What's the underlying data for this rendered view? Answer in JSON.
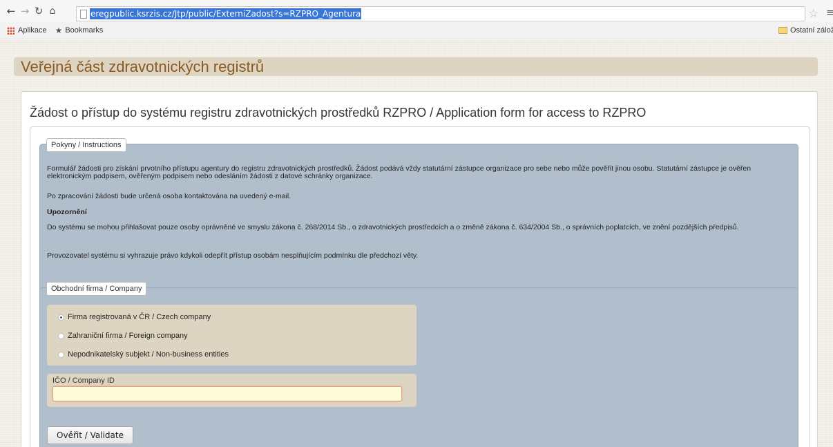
{
  "browser": {
    "url": "eregpublic.ksrzis.cz/Jtp/public/ExterniZadost?s=RZPRO_Agentura",
    "bookmarks": {
      "apps_label": "Aplikace",
      "bookmarks_label": "Bookmarks",
      "other_label": "Ostatní záložky"
    }
  },
  "site": {
    "title": "Veřejná část zdravotnických registrů"
  },
  "form": {
    "title": "Žádost o přístup do systému registru zdravotnických prostředků RZPRO / Application form for access to RZPRO",
    "instructions": {
      "legend": "Pokyny / Instructions",
      "p1": "Formulář žádosti pro získání prvotního přístupu agentury do registru zdravotnických prostředků. Žádost podává vždy statutární zástupce organizace pro sebe nebo může pověřit jinou osobu. Statutární zástupce je ověřen elektronickým podpisem, ověřeným podpisem nebo odesláním žádosti z datové schránky organizace.",
      "p2": "Po zpracování žádosti bude určená osoba kontaktována na uvedený e-mail.",
      "warning_heading": "Upozornění",
      "p3": "Do systému se mohou přihlašovat pouze osoby oprávněné ve smyslu zákona č. 268/2014 Sb., o zdravotnických prostředcích a o změně zákona č. 634/2004 Sb., o správních poplatcích, ve znění pozdějších předpisů.",
      "p4": "Provozovatel systému si vyhrazuje právo kdykoli odepřít přístup osobám nesplňujícím podmínku dle předchozí věty."
    },
    "company": {
      "legend": "Obchodní firma / Company",
      "options": [
        {
          "label": "Firma registrovaná v ČR / Czech company",
          "checked": true
        },
        {
          "label": "Zahraniční firma / Foreign company",
          "checked": false
        },
        {
          "label": "Nepodnikatelský subjekt / Non-business entities",
          "checked": false
        }
      ],
      "ico_label": "IČO / Company ID",
      "ico_value": "",
      "validate_label": "Ověřit / Validate"
    }
  }
}
